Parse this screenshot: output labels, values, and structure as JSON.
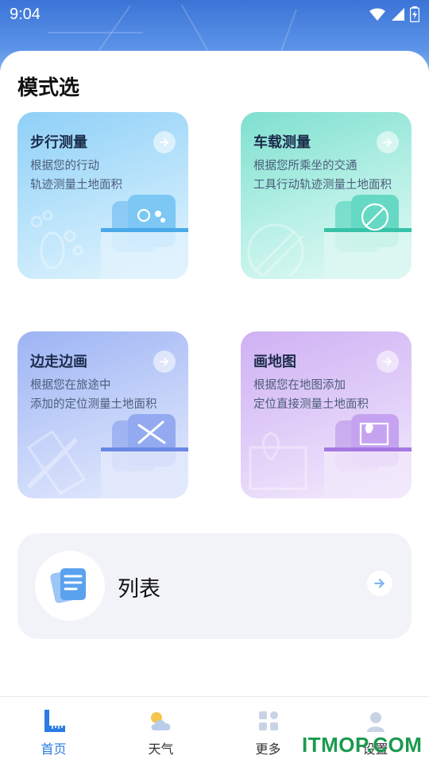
{
  "status_bar": {
    "time": "9:04"
  },
  "page": {
    "section_title": "模式选"
  },
  "cards": [
    {
      "title": "步行测量",
      "description": "根据您的行动\n轨迹测量土地面积"
    },
    {
      "title": "车载测量",
      "description": "根据您所乘坐的交通\n工具行动轨迹测量土地面积"
    },
    {
      "title": "边走边画",
      "description": "根据您在旅途中\n添加的定位测量土地面积"
    },
    {
      "title": "画地图",
      "description": "根据您在地图添加\n定位直接测量土地面积"
    }
  ],
  "list_entry": {
    "label": "列表"
  },
  "tabs": [
    {
      "label": "首页",
      "icon": "ruler-icon",
      "active": true
    },
    {
      "label": "天气",
      "icon": "weather-icon",
      "active": false
    },
    {
      "label": "更多",
      "icon": "grid-icon",
      "active": false
    },
    {
      "label": "设置",
      "icon": "user-icon",
      "active": false
    }
  ],
  "watermark": "ITMOP.COM",
  "colors": {
    "accent": "#2a7be4",
    "walk": "#8fd0f7",
    "vehicle": "#7ee0cf",
    "walkdraw": "#9db4f4",
    "map": "#cfb1f3"
  }
}
